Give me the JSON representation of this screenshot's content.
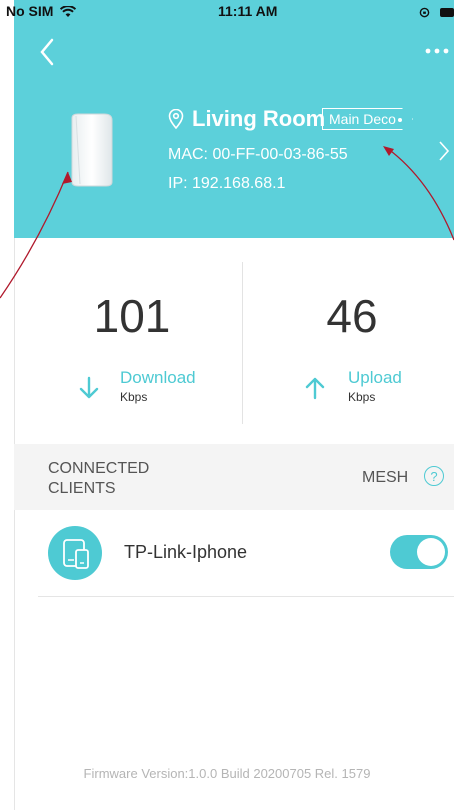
{
  "status_bar": {
    "carrier": "No SIM",
    "time": "11:11 AM"
  },
  "header": {
    "location_name": "Living Room",
    "badge_label": "Main Deco",
    "mac": "MAC: 00-FF-00-03-86-55",
    "ip": "IP: 192.168.68.1"
  },
  "stats": {
    "download": {
      "value": "101",
      "label": "Download",
      "unit": "Kbps"
    },
    "upload": {
      "value": "46",
      "label": "Upload",
      "unit": "Kbps"
    }
  },
  "clients_section": {
    "title": "CONNECTED CLIENTS",
    "mesh_label": "MESH",
    "help_symbol": "?"
  },
  "clients": [
    {
      "name": "TP-Link-Iphone",
      "enabled": true
    }
  ],
  "footer": {
    "firmware": "Firmware Version:1.0.0 Build 20200705 Rel. 1579"
  },
  "colors": {
    "header_bg": "#5cd0da",
    "accent": "#4ecad3",
    "annotation": "#b0192c"
  },
  "icons": {
    "back": "chevron-left-icon",
    "more": "more-dots-icon",
    "location": "location-pin-icon",
    "download": "arrow-down-icon",
    "upload": "arrow-up-icon",
    "help": "help-circle-icon",
    "client": "devices-icon"
  }
}
